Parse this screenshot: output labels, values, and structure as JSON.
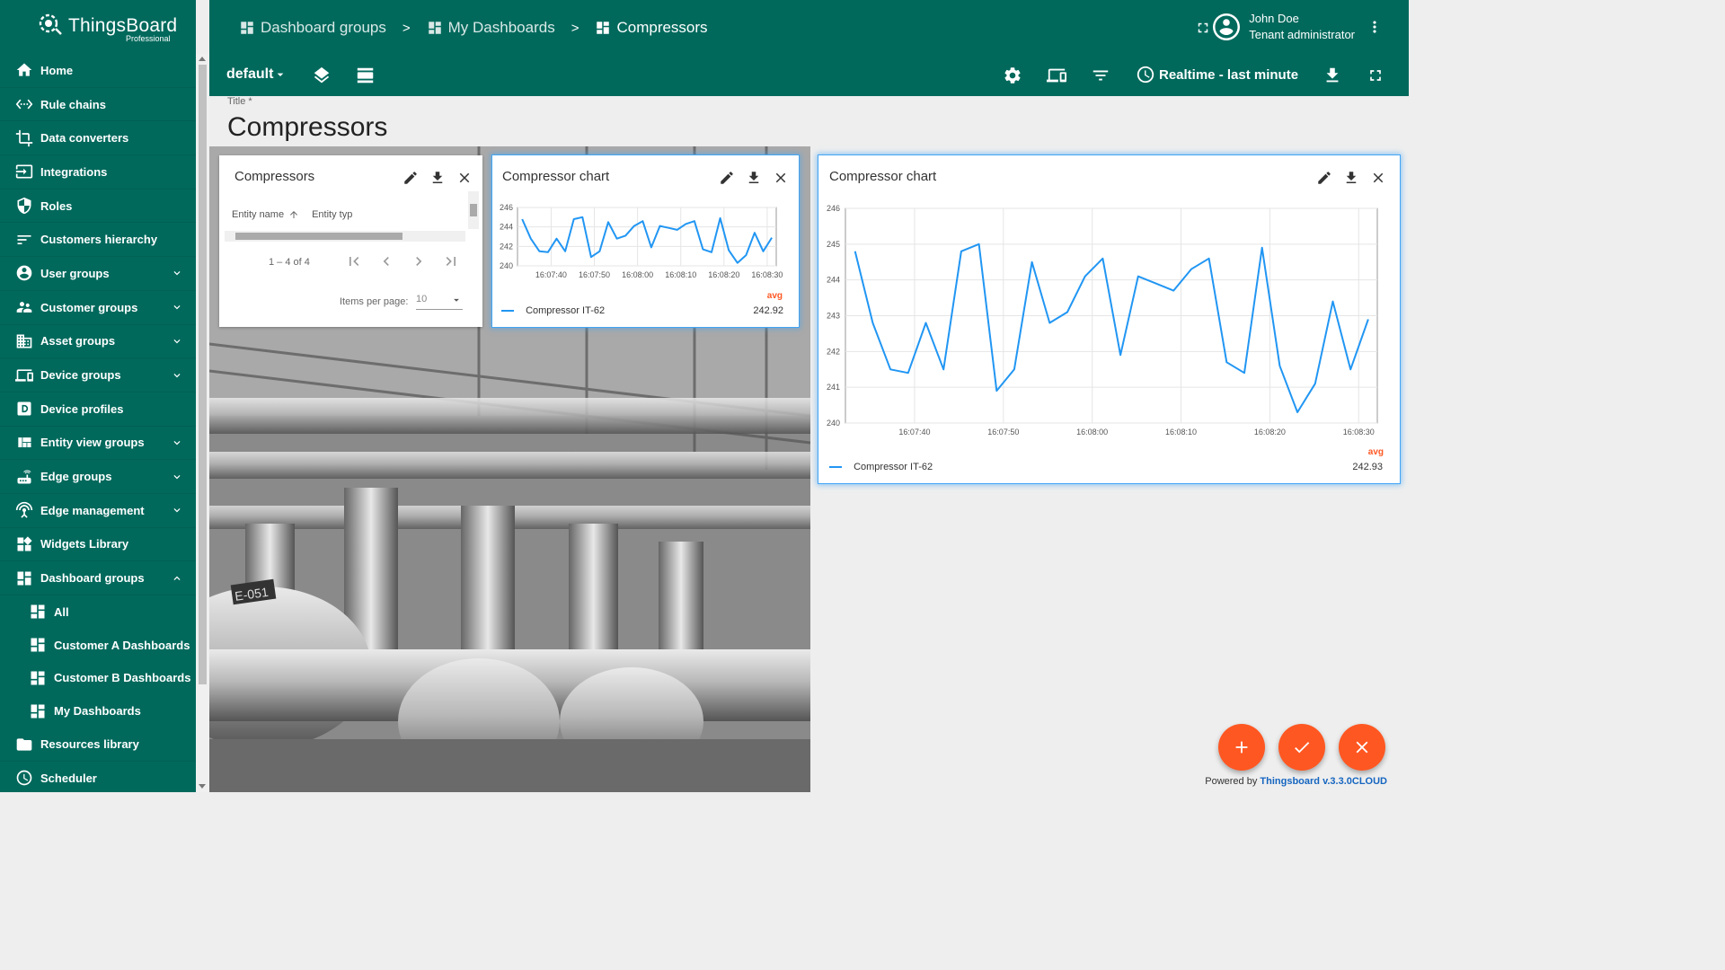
{
  "app": {
    "name": "ThingsBoard",
    "edition": "Professional"
  },
  "sidebar": {
    "items": [
      {
        "label": "Home",
        "icon": "home-icon"
      },
      {
        "label": "Rule chains",
        "icon": "rule-chains-icon"
      },
      {
        "label": "Data converters",
        "icon": "data-converters-icon"
      },
      {
        "label": "Integrations",
        "icon": "integrations-icon"
      },
      {
        "label": "Roles",
        "icon": "shield-icon"
      },
      {
        "label": "Customers hierarchy",
        "icon": "sort-icon"
      },
      {
        "label": "User groups",
        "icon": "account-circle-icon",
        "expandable": true
      },
      {
        "label": "Customer groups",
        "icon": "supervisor-icon",
        "expandable": true
      },
      {
        "label": "Asset groups",
        "icon": "domain-icon",
        "expandable": true
      },
      {
        "label": "Device groups",
        "icon": "devices-icon",
        "expandable": true
      },
      {
        "label": "Device profiles",
        "icon": "device-profile-icon"
      },
      {
        "label": "Entity view groups",
        "icon": "view-quilt-icon",
        "expandable": true
      },
      {
        "label": "Edge groups",
        "icon": "router-icon",
        "expandable": true
      },
      {
        "label": "Edge management",
        "icon": "settings-input-antenna-icon",
        "expandable": true
      },
      {
        "label": "Widgets Library",
        "icon": "widgets-icon"
      },
      {
        "label": "Dashboard groups",
        "icon": "dashboard-icon",
        "expanded": true
      },
      {
        "label": "All",
        "icon": "dashboard-icon",
        "sub": true
      },
      {
        "label": "Customer A Dashboards",
        "icon": "dashboard-icon",
        "sub": true
      },
      {
        "label": "Customer B Dashboards",
        "icon": "dashboard-icon",
        "sub": true
      },
      {
        "label": "My Dashboards",
        "icon": "dashboard-icon",
        "sub": true
      },
      {
        "label": "Resources library",
        "icon": "folder-icon"
      },
      {
        "label": "Scheduler",
        "icon": "schedule-icon"
      }
    ]
  },
  "breadcrumb": [
    {
      "label": "Dashboard groups"
    },
    {
      "label": "My Dashboards"
    },
    {
      "label": "Compressors"
    }
  ],
  "breadcrumb_sep": ">",
  "user": {
    "name": "John Doe",
    "role": "Tenant administrator"
  },
  "toolbar": {
    "state": "default",
    "timewindow": "Realtime - last minute"
  },
  "title_field": {
    "label": "Title *",
    "value": "Compressors"
  },
  "entities_widget": {
    "title": "Compressors",
    "columns": [
      "Entity name",
      "Entity typ"
    ],
    "paging": "1 – 4 of 4",
    "items_per_page_label": "Items per page:",
    "items_per_page_value": "10"
  },
  "small_chart": {
    "title": "Compressor chart",
    "legend_header": "avg",
    "legend_series": "Compressor IT-62",
    "legend_value": "242.92"
  },
  "large_chart": {
    "title": "Compressor chart",
    "legend_header": "avg",
    "legend_series": "Compressor IT-62",
    "legend_value": "242.93"
  },
  "chart_data": [
    {
      "type": "line",
      "title": "Compressor chart",
      "x_ticks": [
        "16:07:40",
        "16:07:50",
        "16:08:00",
        "16:08:10",
        "16:08:20",
        "16:08:30"
      ],
      "y_ticks": [
        240,
        242,
        244,
        246
      ],
      "ylim": [
        240,
        246
      ],
      "series": [
        {
          "name": "Compressor IT-62",
          "color": "#2196f3",
          "values": [
            244.8,
            242.8,
            241.5,
            241.4,
            242.8,
            241.5,
            244.8,
            245.0,
            240.9,
            241.5,
            244.5,
            242.8,
            243.1,
            244.1,
            244.6,
            241.9,
            244.1,
            243.9,
            243.7,
            244.3,
            244.6,
            241.7,
            241.4,
            244.9,
            241.6,
            240.3,
            241.1,
            243.4,
            241.5,
            242.9
          ]
        }
      ]
    },
    {
      "type": "line",
      "title": "Compressor chart",
      "x_ticks": [
        "16:07:40",
        "16:07:50",
        "16:08:00",
        "16:08:10",
        "16:08:20",
        "16:08:30"
      ],
      "y_ticks": [
        240,
        241,
        242,
        243,
        244,
        245,
        246
      ],
      "ylim": [
        240,
        246
      ],
      "series": [
        {
          "name": "Compressor IT-62",
          "color": "#2196f3",
          "values": [
            244.8,
            242.8,
            241.5,
            241.4,
            242.8,
            241.5,
            244.8,
            245.0,
            240.9,
            241.5,
            244.5,
            242.8,
            243.1,
            244.1,
            244.6,
            241.9,
            244.1,
            243.9,
            243.7,
            244.3,
            244.6,
            241.7,
            241.4,
            244.9,
            241.6,
            240.3,
            241.1,
            243.4,
            241.5,
            242.9
          ]
        }
      ]
    }
  ],
  "fabs": [
    {
      "icon": "plus-icon"
    },
    {
      "icon": "check-icon"
    },
    {
      "icon": "close-icon"
    }
  ],
  "footer": {
    "prefix": "Powered by ",
    "link": "Thingsboard v.3.3.0CLOUD"
  },
  "colors": {
    "primary": "#00695c",
    "accent": "#ff5722",
    "series": "#2196f3",
    "legend_header": "#ff5722"
  }
}
